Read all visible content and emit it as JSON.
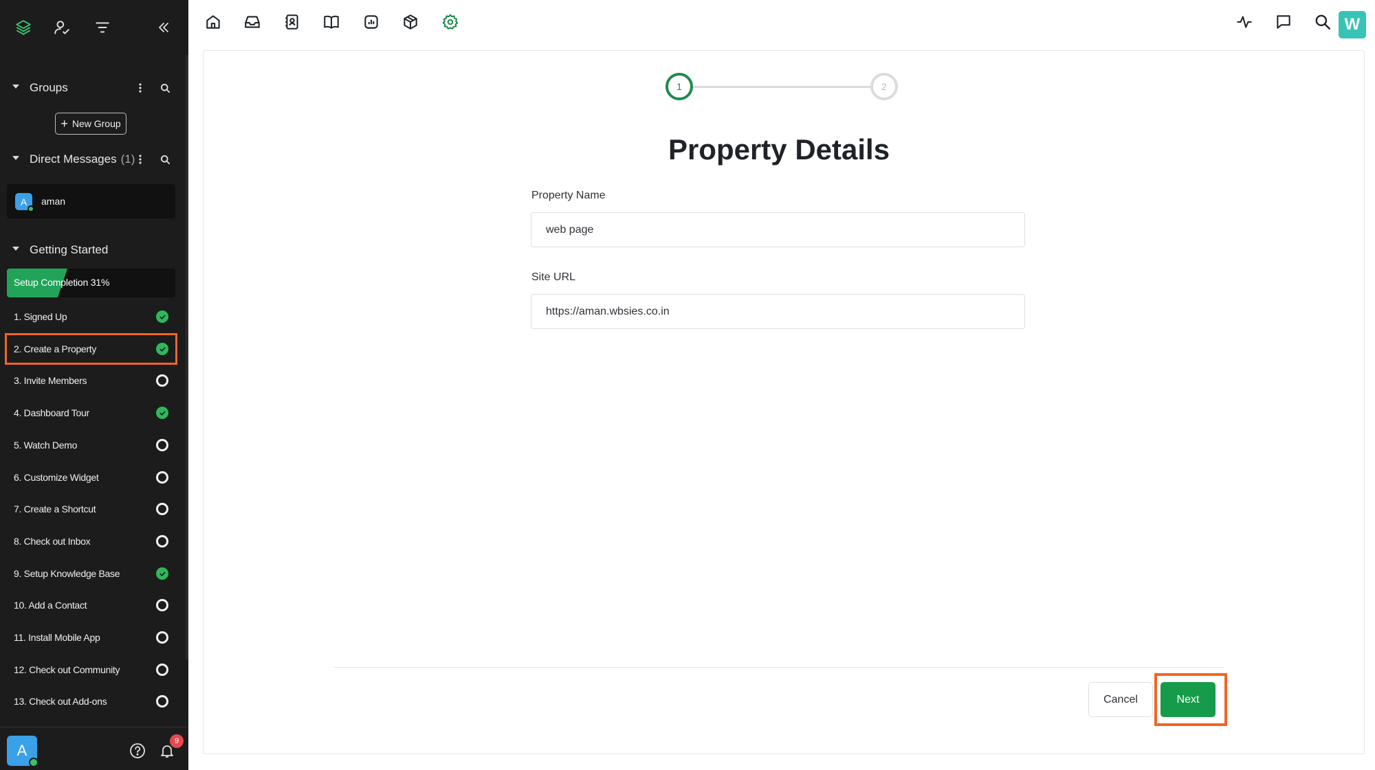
{
  "sidebar": {
    "groups": {
      "title": "Groups",
      "new_group_label": "New Group"
    },
    "direct_messages": {
      "title": "Direct Messages",
      "count": "(1)",
      "items": [
        {
          "initial": "A",
          "name": "aman"
        }
      ]
    },
    "getting_started": {
      "title": "Getting Started",
      "progress_label": "Setup Completion 31%",
      "progress_percent": 31,
      "tasks": [
        {
          "label": "1. Signed Up",
          "status": "done"
        },
        {
          "label": "2. Create a Property",
          "status": "done",
          "highlighted": true
        },
        {
          "label": "3. Invite Members",
          "status": "todo"
        },
        {
          "label": "4. Dashboard Tour",
          "status": "done"
        },
        {
          "label": "5. Watch Demo",
          "status": "todo"
        },
        {
          "label": "6. Customize Widget",
          "status": "todo"
        },
        {
          "label": "7. Create a Shortcut",
          "status": "todo"
        },
        {
          "label": "8. Check out Inbox",
          "status": "todo"
        },
        {
          "label": "9. Setup Knowledge Base",
          "status": "done"
        },
        {
          "label": "10. Add a Contact",
          "status": "todo"
        },
        {
          "label": "11. Install Mobile App",
          "status": "todo"
        },
        {
          "label": "12. Check out Community",
          "status": "todo"
        },
        {
          "label": "13. Check out Add-ons",
          "status": "todo"
        }
      ]
    },
    "footer": {
      "user_initial": "A",
      "notification_count": "9"
    }
  },
  "topbar": {
    "nav_icons": [
      "home-icon",
      "inbox-icon",
      "contacts-icon",
      "knowledge-base-icon",
      "reports-icon",
      "addons-icon",
      "settings-icon"
    ],
    "right_icons": [
      "activity-icon",
      "chat-icon",
      "search-icon"
    ],
    "workspace_initial": "W"
  },
  "wizard": {
    "steps": [
      {
        "number": "1",
        "state": "active"
      },
      {
        "number": "2",
        "state": "inactive"
      }
    ],
    "title": "Property Details",
    "fields": {
      "property_name": {
        "label": "Property Name",
        "value": "web page"
      },
      "site_url": {
        "label": "Site URL",
        "value": "https://aman.wbsies.co.in"
      }
    },
    "cancel_label": "Cancel",
    "next_label": "Next"
  },
  "colors": {
    "sidebar_bg": "#1c1c1c",
    "accent_green": "#169b4b",
    "highlight_orange": "#f26522",
    "avatar_blue": "#3aa0e8",
    "workspace_teal": "#38c3b6"
  }
}
